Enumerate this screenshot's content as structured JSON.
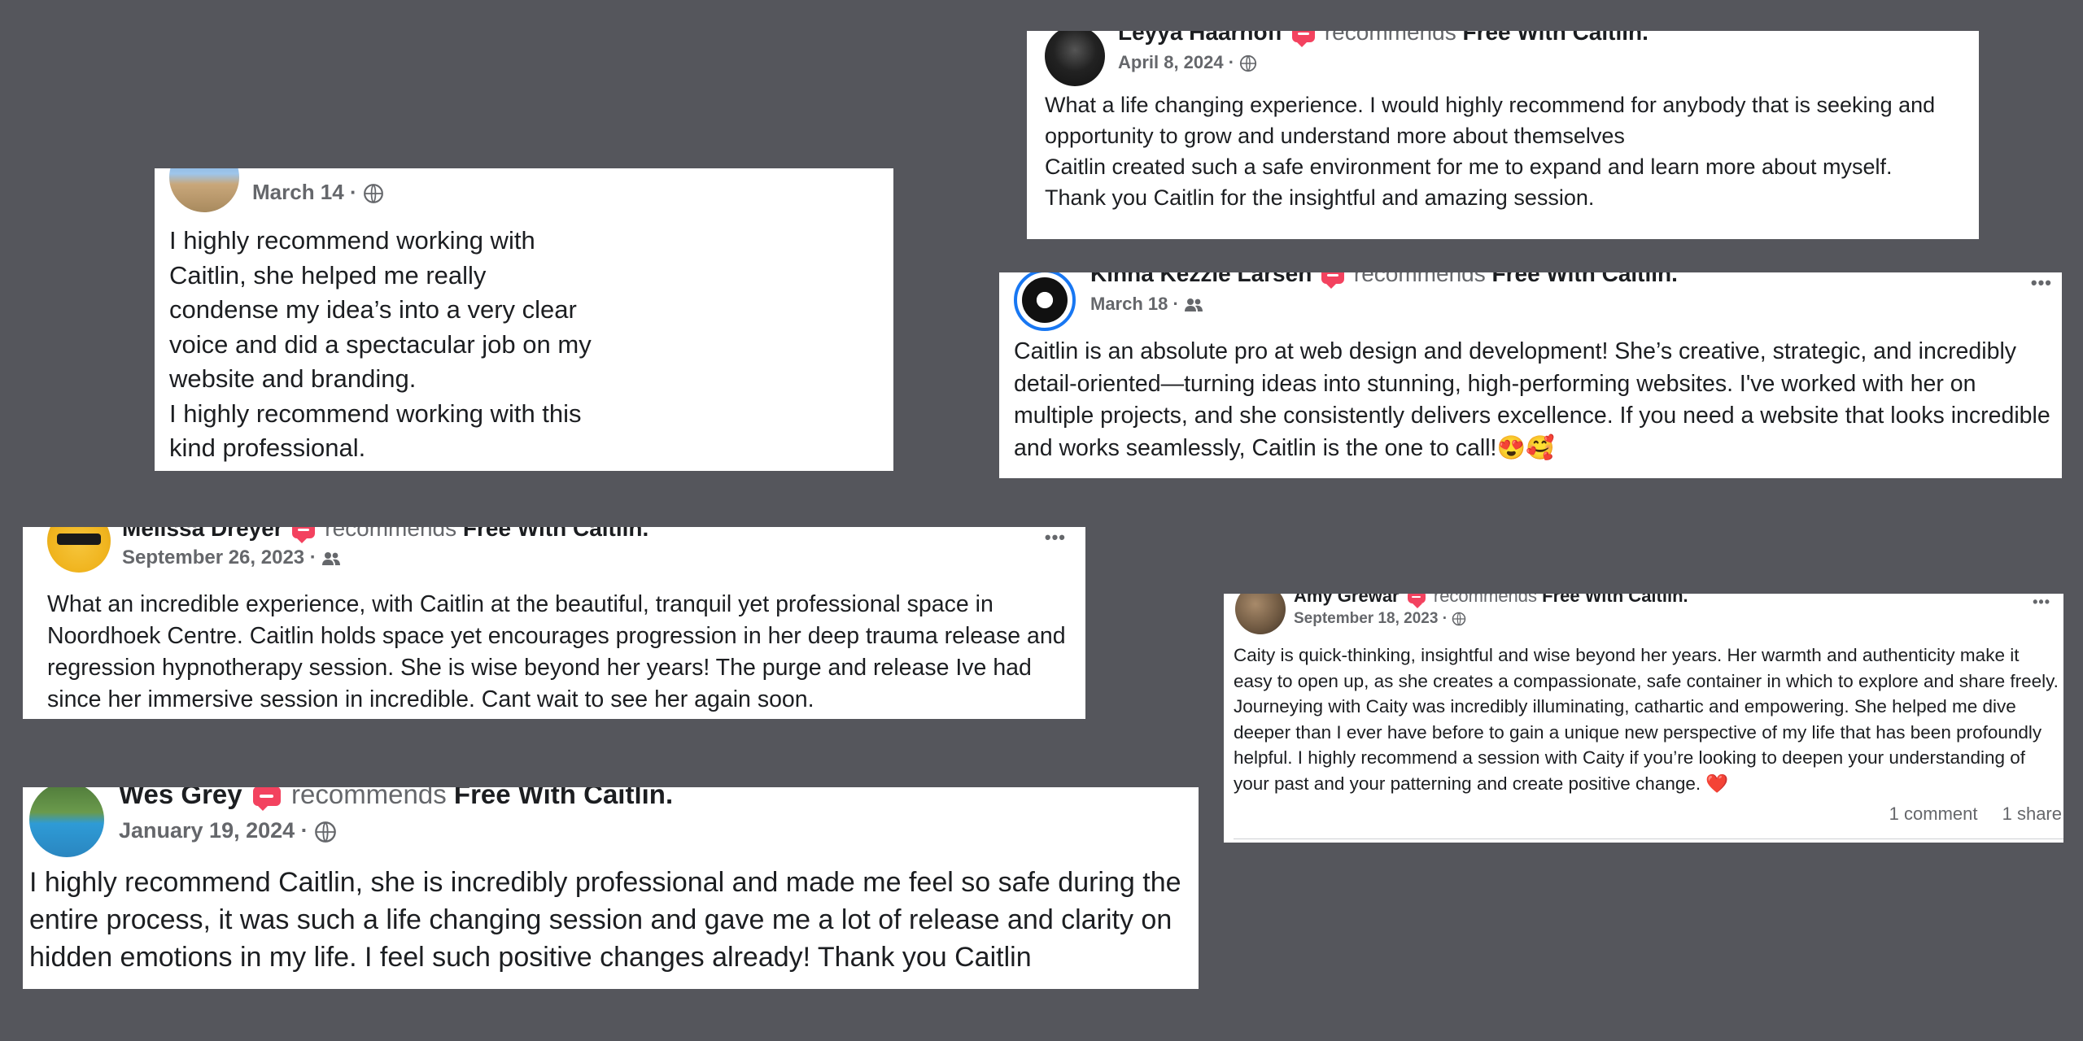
{
  "recommends_label": "recommends",
  "page_name": "Free With Caitlin.",
  "more_icon": "•••",
  "colors": {
    "background": "#55565c",
    "accent": "#f3425f"
  },
  "reviews": [
    {
      "name": "Leyya Haarhoff",
      "date": "April 8, 2024 ·",
      "audience_icon": "globe-icon",
      "paragraphs": [
        "What a life changing experience. I would highly recommend for anybody that is seeking and opportunity to grow and understand more about themselves",
        "Caitlin created such a safe environment for me to expand and learn more about myself.",
        "Thank you Caitlin for the insightful and amazing session."
      ]
    },
    {
      "name": "",
      "date": "March 14 ·",
      "audience_icon": "globe-icon",
      "paragraphs": [
        "I highly recommend working with Caitlin, she helped me really condense my idea’s into a very clear voice and did a spectacular job on my website and branding.",
        "I highly recommend working with this kind professional."
      ]
    },
    {
      "name": "Kinna Kezzie Larsen",
      "date": "March 18 ·",
      "audience_icon": "friends-icon",
      "paragraphs": [
        "Caitlin is an absolute pro at web design and development! She’s creative, strategic, and incredibly detail-oriented—turning ideas into stunning, high-performing websites. I've worked with her on multiple projects, and she consistently delivers excellence. If you need a website that looks incredible and works seamlessly, Caitlin is the one to call!😍🥰"
      ]
    },
    {
      "name": "Melissa Dreyer",
      "date": "September 26, 2023 ·",
      "audience_icon": "friends-icon",
      "paragraphs": [
        "What an incredible experience, with Caitlin at the beautiful, tranquil yet professional space in Noordhoek Centre. Caitlin holds space yet encourages progression in her deep trauma release and regression hypnotherapy session. She is wise beyond her years! The purge and release Ive had since her immersive session in incredible. Cant wait to see her again soon."
      ]
    },
    {
      "name": "Amy Grewar",
      "date": "September 18, 2023 ·",
      "audience_icon": "globe-icon",
      "paragraphs": [
        "Caity is quick-thinking, insightful and wise beyond her years. Her warmth and authenticity make it easy to open up, as she creates a compassionate, safe container in which to explore and share freely. Journeying with Caity was incredibly illuminating, cathartic and empowering. She helped me dive deeper than I ever have before to gain a unique new perspective of my life that has been profoundly helpful. I highly recommend a session with Caity if you’re looking to deepen your understanding of your past and your patterning and create positive change. ❤️"
      ],
      "comments": "1 comment",
      "shares": "1 share"
    },
    {
      "name": "Wes Grey",
      "date": "January 19, 2024 ·",
      "audience_icon": "globe-icon",
      "paragraphs": [
        "I highly recommend Caitlin, she is incredibly professional and made me feel so safe during the entire process, it was such a life changing session and gave me a lot of release and clarity on hidden emotions in my life. I feel such positive changes already! Thank you Caitlin"
      ]
    }
  ]
}
